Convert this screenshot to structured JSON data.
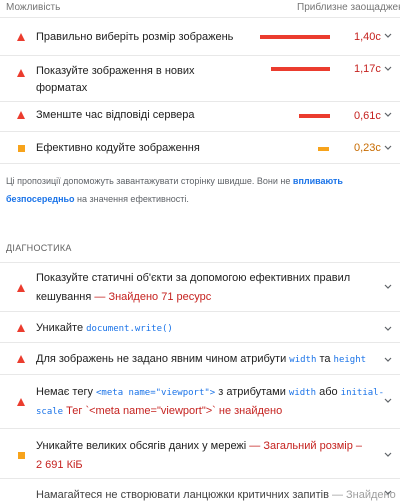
{
  "header": {
    "left": "Можливість",
    "right": "Приблизне заощадження"
  },
  "opportunities": [
    {
      "label": "Правильно виберіть розмір зображень",
      "value": "1,40с",
      "severity": "red",
      "bar_fraction": 1.0
    },
    {
      "label_line1": "Показуйте зображення в нових",
      "label_line2": "форматах",
      "value": "1,17с",
      "severity": "red",
      "bar_fraction": 0.84
    },
    {
      "label": "Зменште час відповіді сервера",
      "value": "0,61с",
      "severity": "red",
      "bar_fraction": 0.44
    },
    {
      "label": "Ефективно кодуйте зображення",
      "value": "0,23с",
      "severity": "orange",
      "bar_fraction": 0.16
    }
  ],
  "note": {
    "line1_pre": "Ці пропозиції допоможуть завантажувати сторінку швидше. Вони не ",
    "line1_link": "впливають",
    "line2_link": "безпосередньо",
    "line2_post": " на значення ефективності."
  },
  "diagnostics_title": "ДІАГНОСТИКА",
  "diagnostics": [
    {
      "line1": "Показуйте статичні об'єкти за допомогою ефективних правил",
      "line2": "кешування",
      "detail": " — Знайдено 71 ресурс",
      "severity": "red"
    },
    {
      "text": "Уникайте ",
      "code": "document.write()",
      "severity": "red"
    },
    {
      "text1": "Для зображень не задано явним чином атрибути ",
      "code1": "width",
      "text2": " та ",
      "code2": "height",
      "severity": "red"
    },
    {
      "text1": "Немає тегу ",
      "code1": "<meta name=\"viewport\">",
      "text2": " з атрибутами ",
      "code2": "width",
      "text3": " або ",
      "code3": "initial-",
      "code4": "scale",
      "detail": " Тег `<meta name=\"viewport\">` не знайдено",
      "severity": "red"
    },
    {
      "line1": "Уникайте великих обсягів даних у мережі",
      "detail1": " — Загальний розмір –",
      "detail2": "2 691 КіБ",
      "severity": "orange"
    },
    {
      "text": "Намагайтеся не створювати ланцюжки критичних запитів",
      "detail": " — Знайдено",
      "severity": "neutral"
    }
  ],
  "colors": {
    "red": "#eb3c2e",
    "orange": "#f7a31b",
    "link": "#1a73e8"
  }
}
